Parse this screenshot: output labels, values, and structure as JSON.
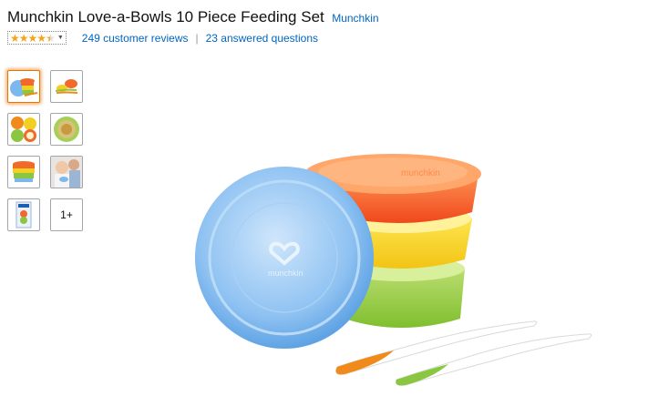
{
  "product": {
    "title": "Munchkin Love-a-Bowls 10 Piece Feeding Set",
    "brand": "Munchkin",
    "rating_stars": 4.5,
    "reviews_text": "249 customer reviews",
    "separator": "|",
    "questions_text": "23 answered questions"
  },
  "gallery": {
    "more_label": "1+",
    "selected_index": 0
  },
  "colors": {
    "link": "#0066c0",
    "star": "#f4a51c",
    "selected_border": "#e77600"
  }
}
